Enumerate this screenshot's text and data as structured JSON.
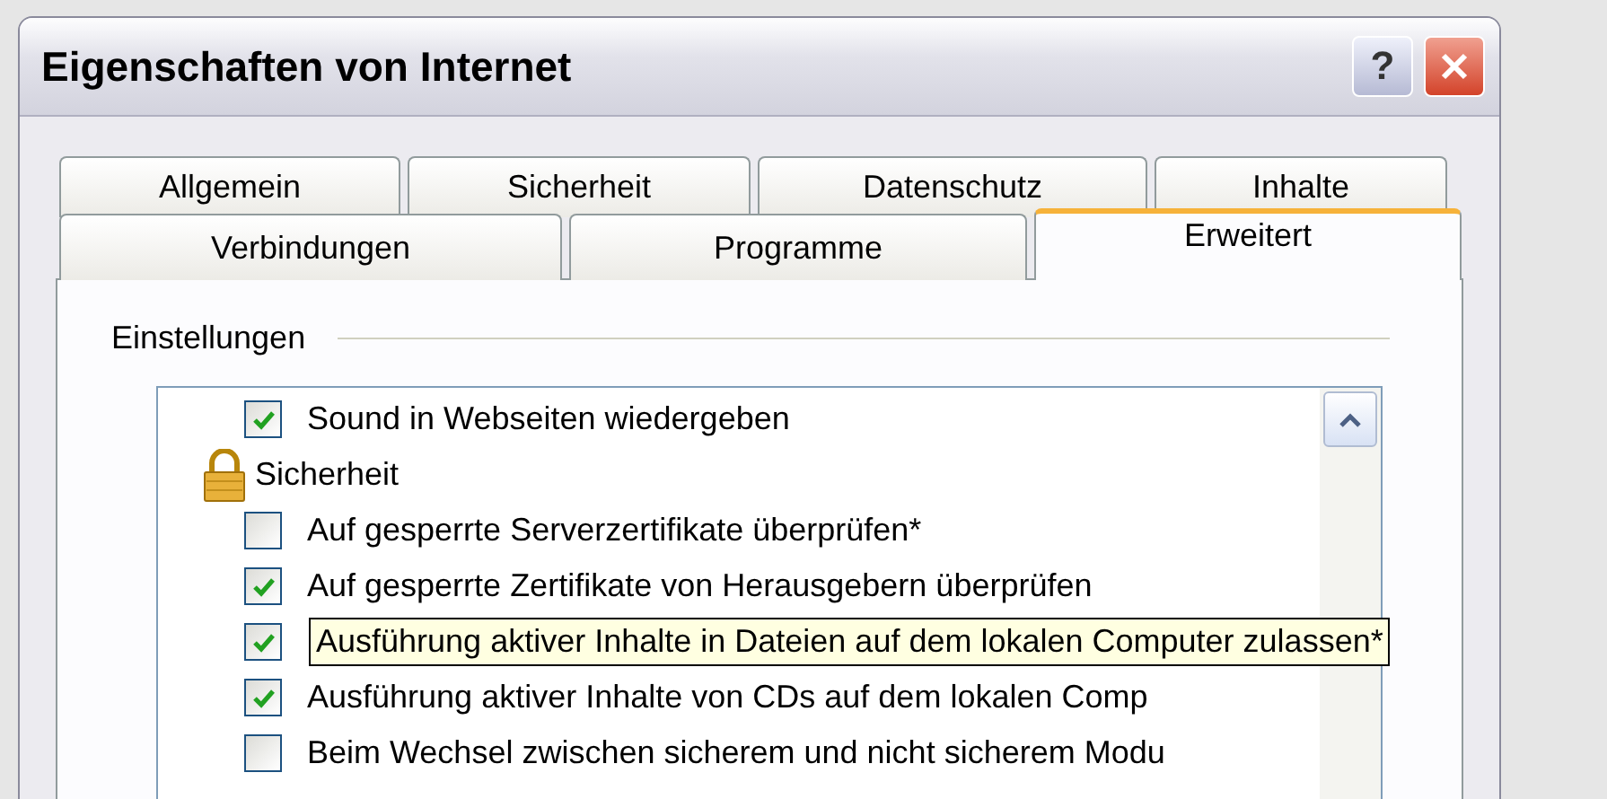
{
  "window": {
    "title": "Eigenschaften von Internet",
    "help_label": "?"
  },
  "tabs": [
    [
      {
        "label": "Allgemein",
        "selected": false
      },
      {
        "label": "Sicherheit",
        "selected": false
      },
      {
        "label": "Datenschutz",
        "selected": false
      },
      {
        "label": "Inhalte",
        "selected": false
      }
    ],
    [
      {
        "label": "Verbindungen",
        "selected": false
      },
      {
        "label": "Programme",
        "selected": false
      },
      {
        "label": "Erweitert",
        "selected": true
      }
    ]
  ],
  "group": {
    "title": "Einstellungen"
  },
  "settings": [
    {
      "kind": "checkbox",
      "label": "Sound in Webseiten wiedergeben",
      "checked": true
    },
    {
      "kind": "category",
      "label": "Sicherheit"
    },
    {
      "kind": "checkbox",
      "label": "Auf gesperrte Serverzertifikate überprüfen*",
      "checked": false
    },
    {
      "kind": "checkbox",
      "label": "Auf gesperrte Zertifikate von Herausgebern überprüfen",
      "checked": true
    },
    {
      "kind": "checkbox",
      "tooltip": "Ausführung aktiver Inhalte in Dateien auf dem lokalen Computer zulassen*",
      "checked": true
    },
    {
      "kind": "checkbox",
      "label": "Ausführung aktiver Inhalte von CDs auf dem lokalen Comp",
      "checked": true
    },
    {
      "kind": "checkbox",
      "label": "Beim Wechsel zwischen sicherem und nicht sicherem Modu",
      "checked": false
    }
  ]
}
